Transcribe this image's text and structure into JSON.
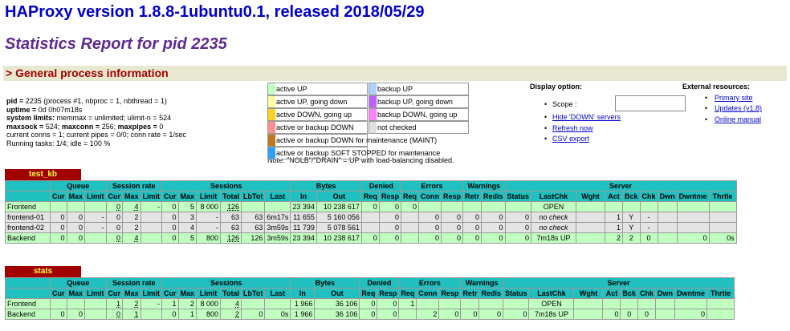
{
  "header": {
    "title": "HAProxy version 1.8.8-1ubuntu0.1, released 2018/05/29",
    "subtitle": "Statistics Report for pid 2235",
    "section": "> General process information"
  },
  "process": {
    "pid_label": "pid = ",
    "pid_value": "2235 (process #1, nbproc = 1, nbthread = 1)",
    "uptime_label": "uptime = ",
    "uptime_value": "0d 0h07m18s",
    "limits_label": "system limits:",
    "limits_value": " memmax = unlimited; ulimit-n = 524",
    "maxsock_label": "maxsock = ",
    "maxsock_value": "524; ",
    "maxconn_label": "maxconn = ",
    "maxconn_value": "256; ",
    "maxpipes_label": "maxpipes = ",
    "maxpipes_value": "0",
    "line5": "current conns = 1; current pipes = 0/0; conn rate = 1/sec",
    "line6": "Running tasks: 1/4; idle = 100 %"
  },
  "legend": {
    "items": [
      {
        "label": "active UP",
        "color": "#c0ffc0",
        "col": 1,
        "row": 0
      },
      {
        "label": "backup UP",
        "color": "#b0d0ff",
        "col": 2,
        "row": 0
      },
      {
        "label": "active UP, going down",
        "color": "#ffffa0",
        "col": 1,
        "row": 1
      },
      {
        "label": "backup UP, going down",
        "color": "#c060ff",
        "col": 2,
        "row": 1
      },
      {
        "label": "active DOWN, going up",
        "color": "#ffd020",
        "col": 1,
        "row": 2
      },
      {
        "label": "backup DOWN, going up",
        "color": "#ff80ff",
        "col": 2,
        "row": 2
      },
      {
        "label": "active or backup DOWN",
        "color": "#ff9090",
        "col": 1,
        "row": 3
      },
      {
        "label": "not checked",
        "color": "#e0e0e0",
        "col": 2,
        "row": 3
      },
      {
        "label": "active or backup DOWN for maintenance (MAINT)",
        "color": "#c07820",
        "col": 1,
        "row": 4
      },
      {
        "label": "active or backup SOFT STOPPED for maintenance",
        "color": "#30a0ff",
        "col": 1,
        "row": 5
      }
    ],
    "note": "Note: \"NOLB\"/\"DRAIN\" = UP with load-balancing disabled."
  },
  "display": {
    "title": "Display option:",
    "scope_label": "Scope :",
    "hide_down": "Hide 'DOWN' servers",
    "refresh": "Refresh now",
    "csv": "CSV export"
  },
  "external": {
    "title": "External resources:",
    "primary": "Primary site",
    "updates": "Updates (v1.8)",
    "manual": "Online manual"
  },
  "headers": {
    "queue": "Queue",
    "session_rate": "Session rate",
    "sessions": "Sessions",
    "bytes": "Bytes",
    "denied": "Denied",
    "errors": "Errors",
    "warnings": "Warnings",
    "server": "Server",
    "cur": "Cur",
    "max": "Max",
    "limit": "Limit",
    "total": "Total",
    "lbtot": "LbTot",
    "last": "Last",
    "in": "In",
    "out": "Out",
    "req": "Req",
    "resp": "Resp",
    "conn": "Conn",
    "retr": "Retr",
    "redis": "Redis",
    "status": "Status",
    "lastchk": "LastChk",
    "wght": "Wght",
    "act": "Act",
    "bck": "Bck",
    "chk": "Chk",
    "dwn": "Dwn",
    "dwntme": "Dwntme",
    "thrtle": "Thrtle"
  },
  "proxies": [
    {
      "name": "test_kb",
      "rows": [
        {
          "type": "fe",
          "cells": [
            "Frontend",
            "",
            "",
            "",
            "0",
            "4",
            "-",
            "0",
            "5",
            "8 000",
            "126",
            "",
            "",
            "23 394",
            "10 238 617",
            "0",
            "0",
            "0",
            "",
            "",
            "",
            "",
            "",
            "OPEN",
            "",
            "",
            "",
            "",
            "",
            "",
            "",
            ""
          ]
        },
        {
          "type": "sv",
          "cells": [
            "frontend-01",
            "0",
            "0",
            "-",
            "0",
            "2",
            "",
            "0",
            "3",
            "-",
            "63",
            "63",
            "6m17s",
            "11 655",
            "5 160 056",
            "",
            "0",
            "",
            "0",
            "0",
            "0",
            "0",
            "0",
            "no check",
            "",
            "1",
            "Y",
            "-",
            "",
            "",
            "",
            ""
          ]
        },
        {
          "type": "sv",
          "cells": [
            "frontend-02",
            "0",
            "0",
            "-",
            "0",
            "2",
            "",
            "0",
            "4",
            "-",
            "63",
            "63",
            "3m59s",
            "11 739",
            "5 078 561",
            "",
            "0",
            "",
            "0",
            "0",
            "0",
            "0",
            "0",
            "no check",
            "",
            "1",
            "Y",
            "-",
            "",
            "",
            "",
            ""
          ]
        },
        {
          "type": "be",
          "cells": [
            "Backend",
            "0",
            "0",
            "",
            "0",
            "4",
            "",
            "0",
            "5",
            "800",
            "126",
            "126",
            "3m59s",
            "23 394",
            "10 238 617",
            "0",
            "0",
            "",
            "0",
            "0",
            "0",
            "0",
            "0",
            "7m18s UP",
            "",
            "2",
            "2",
            "0",
            "",
            "0",
            "0s",
            ""
          ]
        }
      ]
    },
    {
      "name": "stats",
      "rows": [
        {
          "type": "fe",
          "cells": [
            "Frontend",
            "",
            "",
            "",
            "1",
            "2",
            "-",
            "1",
            "2",
            "8 000",
            "4",
            "",
            "",
            "1 966",
            "36 106",
            "0",
            "0",
            "1",
            "",
            "",
            "",
            "",
            "",
            "OPEN",
            "",
            "",
            "",
            "",
            "",
            "",
            "",
            ""
          ]
        },
        {
          "type": "be",
          "cells": [
            "Backend",
            "0",
            "0",
            "",
            "0",
            "1",
            "",
            "0",
            "1",
            "800",
            "2",
            "0",
            "0s",
            "1 966",
            "36 106",
            "0",
            "0",
            "",
            "2",
            "0",
            "0",
            "0",
            "0",
            "7m18s UP",
            "",
            "0",
            "0",
            "0",
            "",
            "0",
            "",
            ""
          ]
        }
      ]
    }
  ]
}
